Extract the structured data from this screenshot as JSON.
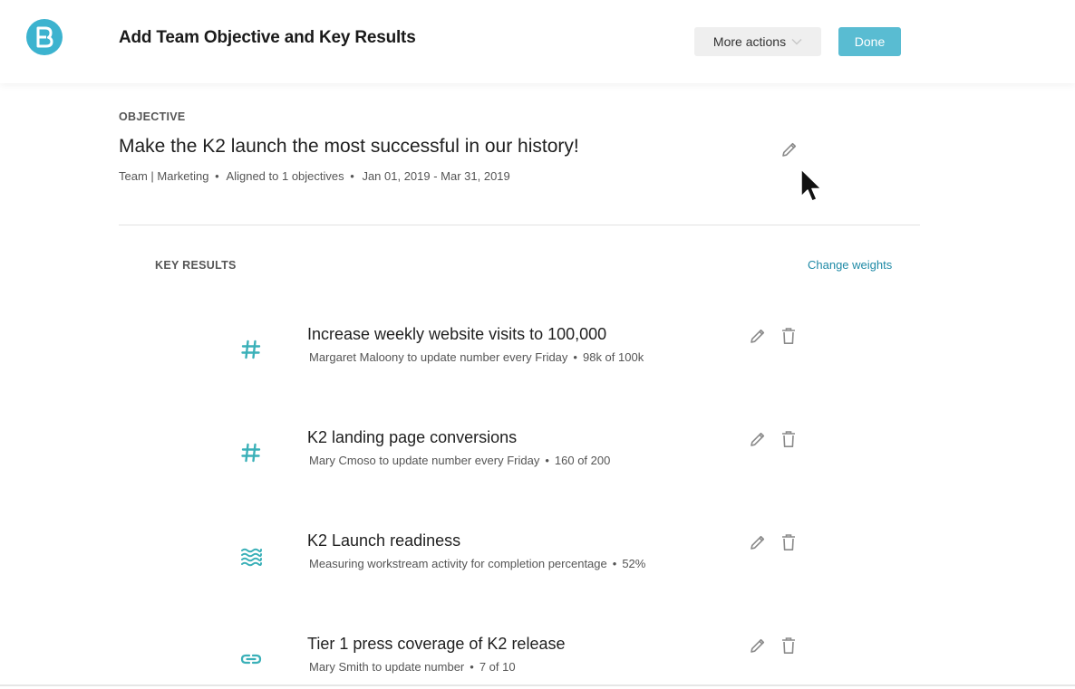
{
  "header": {
    "title": "Add Team Objective and Key Results",
    "more_actions_label": "More actions",
    "done_label": "Done"
  },
  "objective": {
    "section_label": "OBJECTIVE",
    "title": "Make the K2 launch the most successful in our history!",
    "owner": "Team | Marketing",
    "alignment": "Aligned to 1 objectives",
    "date_range": "Jan 01, 2019 - Mar 31, 2019"
  },
  "key_results": {
    "section_label": "KEY RESULTS",
    "change_weights_label": "Change weights",
    "items": [
      {
        "icon": "hash-icon",
        "title": "Increase weekly website visits to 100,000",
        "owner_text": "Margaret Maloony to update number every Friday",
        "progress": "98k of 100k"
      },
      {
        "icon": "hash-icon",
        "title": "K2 landing page conversions",
        "owner_text": "Mary Cmoso to update number every Friday",
        "progress": "160 of 200"
      },
      {
        "icon": "waves-icon",
        "title": "K2 Launch readiness",
        "owner_text": "Measuring workstream activity for completion percentage",
        "progress": "52%"
      },
      {
        "icon": "link-icon",
        "title": "Tier 1 press coverage of K2 release",
        "owner_text": "Mary Smith to update number",
        "progress": "7 of 10"
      }
    ]
  },
  "colors": {
    "accent": "#59bcd2",
    "link": "#1f8aa6",
    "icon_teal": "#3ab0b8"
  }
}
